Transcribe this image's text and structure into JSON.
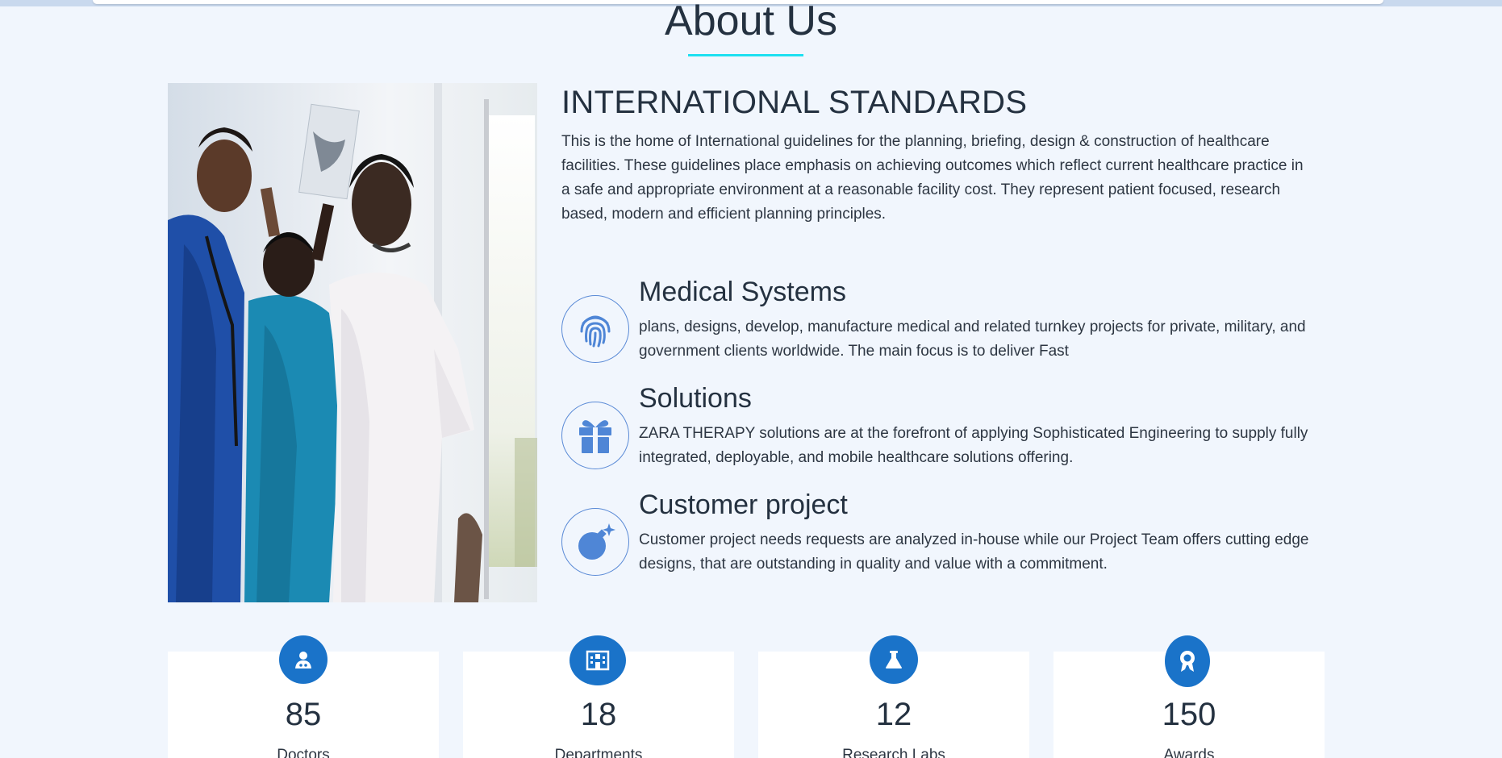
{
  "about": {
    "title": "About Us",
    "heading": "INTERNATIONAL STANDARDS",
    "intro": "This is the home of International guidelines for the planning, briefing, design & construction of healthcare facilities. These guidelines place emphasis on achieving outcomes which reflect current healthcare practice in a safe and appropriate environment at a reasonable facility cost. They represent patient focused, research based, modern and efficient planning principles."
  },
  "features": [
    {
      "icon": "fingerprint-icon",
      "title": "Medical Systems",
      "text": "plans, designs, develop, manufacture medical and related turnkey projects for private, military, and government clients worldwide. The main focus is to deliver Fast"
    },
    {
      "icon": "gift-icon",
      "title": "Solutions",
      "text": "ZARA THERAPY solutions are at the forefront of applying Sophisticated Engineering to supply fully integrated, deployable, and mobile healthcare solutions offering."
    },
    {
      "icon": "bomb-icon",
      "title": "Customer project",
      "text": "Customer project needs requests are analyzed in-house while our Project Team offers cutting edge designs, that are outstanding in quality and value with a commitment."
    }
  ],
  "stats": [
    {
      "icon": "doctor-icon",
      "value": "85",
      "label": "Doctors"
    },
    {
      "icon": "hospital-icon",
      "value": "18",
      "label": "Departments"
    },
    {
      "icon": "flask-icon",
      "value": "12",
      "label": "Research Labs"
    },
    {
      "icon": "award-icon",
      "value": "150",
      "label": "Awards"
    }
  ],
  "colors": {
    "background": "#f1f6fd",
    "accent": "#1a73c9",
    "underline": "#1ee0f0",
    "icon_blue": "#4f86d6"
  }
}
